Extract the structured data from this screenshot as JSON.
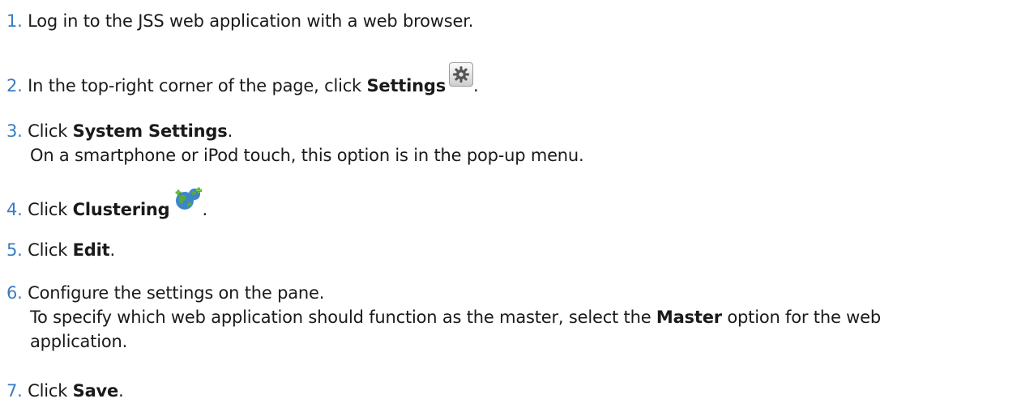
{
  "steps": [
    {
      "num": "1.",
      "text": "Log in to the JSS web application with a web browser."
    },
    {
      "num": "2.",
      "before": "In the top-right corner of the page, click ",
      "ui": "Settings",
      "after": ".",
      "icon": "gear-icon"
    },
    {
      "num": "3.",
      "before": "Click ",
      "ui": "System Settings",
      "after": ".",
      "note": "On a smartphone or iPod touch, this option is in the pop-up menu."
    },
    {
      "num": "4.",
      "before": "Click ",
      "ui": "Clustering",
      "after": ".",
      "icon": "globe-cluster-icon"
    },
    {
      "num": "5.",
      "before": "Click ",
      "ui": "Edit",
      "after": "."
    },
    {
      "num": "6.",
      "text": "Configure the settings on the pane.",
      "note_before": "To specify which web application should function as the master, select the ",
      "note_ui": "Master",
      "note_after": " option for the web",
      "note_cont": "application."
    },
    {
      "num": "7.",
      "before": "Click ",
      "ui": "Save",
      "after": "."
    }
  ],
  "colors": {
    "number": "#3a7cc1",
    "text": "#1a1a1a"
  }
}
